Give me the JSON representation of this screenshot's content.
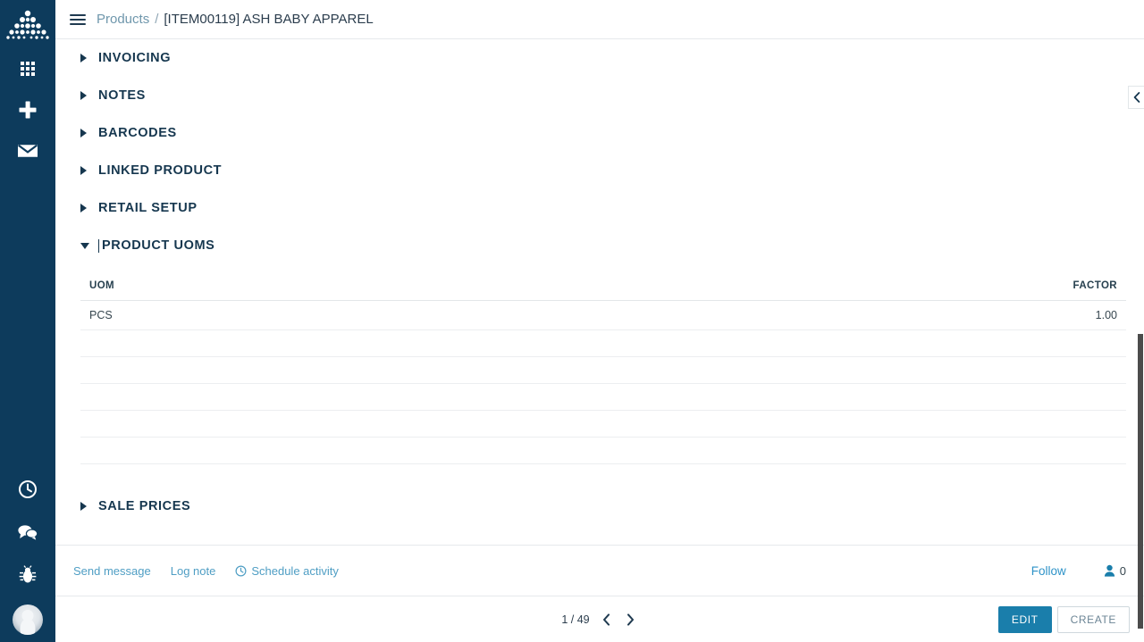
{
  "sidebar": {
    "logo_name": "pyramid-dots-logo",
    "top_items": [
      {
        "name": "apps-grid-icon",
        "label": "Apps"
      },
      {
        "name": "plus-icon",
        "label": "New"
      },
      {
        "name": "mail-icon",
        "label": "Messages"
      }
    ],
    "bottom_items": [
      {
        "name": "clock-icon",
        "label": "Activities"
      },
      {
        "name": "chat-icon",
        "label": "Messages"
      },
      {
        "name": "bug-icon",
        "label": "Debug"
      }
    ],
    "avatar_label": "User menu"
  },
  "breadcrumb": {
    "menu_label": "Toggle menu",
    "root": "Products",
    "separator": "/",
    "current": "[ITEM00119] ASH BABY APPAREL"
  },
  "form": {
    "groups": [
      {
        "title": "INVOICING",
        "expanded": false
      },
      {
        "title": "NOTES",
        "expanded": false
      },
      {
        "title": "BARCODES",
        "expanded": false
      },
      {
        "title": "LINKED PRODUCT",
        "expanded": false
      },
      {
        "title": "RETAIL SETUP",
        "expanded": false
      },
      {
        "title": "PRODUCT UOMS",
        "expanded": true
      }
    ],
    "sale_prices": {
      "title": "SALE PRICES",
      "expanded": false
    }
  },
  "uom_table": {
    "columns": [
      "UOM",
      "FACTOR"
    ],
    "rows": [
      {
        "uom": "PCS",
        "factor": "1.00"
      }
    ],
    "empty_rows": 5
  },
  "chatter": {
    "send_message": "Send message",
    "log_note": "Log note",
    "schedule_activity": "Schedule activity",
    "schedule_icon": "clock-icon",
    "follow": "Follow",
    "followers_icon": "user-icon",
    "followers_count": "0"
  },
  "footer": {
    "pager": "1 / 49",
    "prev_label": "Previous",
    "next_label": "Next",
    "edit": "EDIT",
    "create": "CREATE"
  },
  "panel": {
    "collapse_icon": "chevron-left-icon"
  },
  "colors": {
    "sidebar_bg": "#0d3b5c",
    "primary": "#1a7eab",
    "heading": "#16374f",
    "link": "#4f9ec4"
  }
}
